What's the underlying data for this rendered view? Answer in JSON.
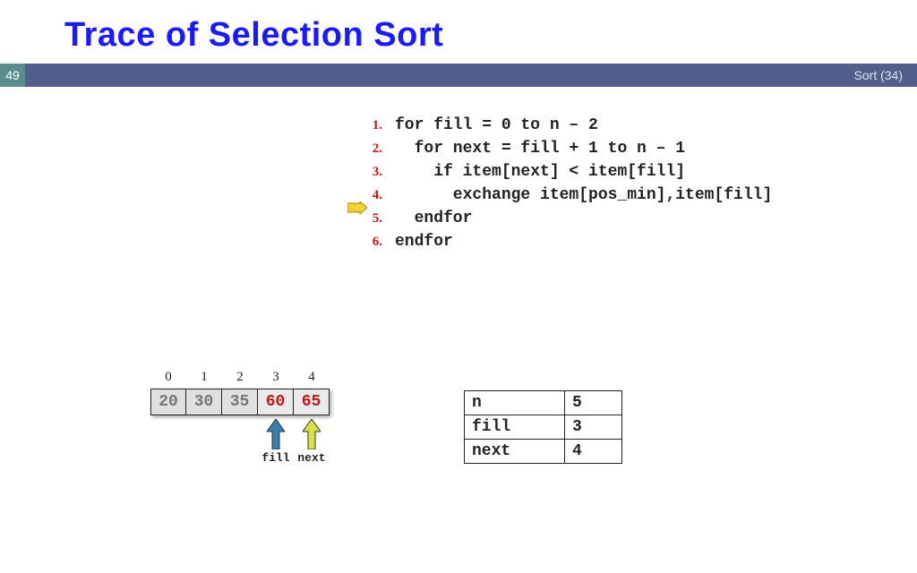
{
  "title": "Trace of Selection Sort",
  "slide_number": "49",
  "header_right": "Sort (34)",
  "code": {
    "active_line_index": 3,
    "lines": [
      {
        "num": "1.",
        "text": "for fill = 0 to n – 2",
        "indent": 0
      },
      {
        "num": "2.",
        "text": "for next = fill + 1 to n – 1",
        "indent": 1
      },
      {
        "num": "3.",
        "text": "if item[next] < item[fill]",
        "indent": 2
      },
      {
        "num": "4.",
        "text": "exchange item[pos_min],item[fill]",
        "indent": 3
      },
      {
        "num": "5.",
        "text": "endfor",
        "indent": 1
      },
      {
        "num": "6.",
        "text": "endfor",
        "indent": 0
      }
    ]
  },
  "array": {
    "indices": [
      "0",
      "1",
      "2",
      "3",
      "4"
    ],
    "cells": [
      {
        "value": "20",
        "highlight": false
      },
      {
        "value": "30",
        "highlight": false
      },
      {
        "value": "35",
        "highlight": false
      },
      {
        "value": "60",
        "highlight": true
      },
      {
        "value": "65",
        "highlight": true
      }
    ],
    "pointers": [
      {
        "slot": 3,
        "label": "fill",
        "color": "#3a7db0"
      },
      {
        "slot": 4,
        "label": "next",
        "color": "#d8e04a"
      }
    ]
  },
  "vars": [
    {
      "name": "n",
      "value": "5"
    },
    {
      "name": "fill",
      "value": "3"
    },
    {
      "name": "next",
      "value": "4"
    }
  ]
}
